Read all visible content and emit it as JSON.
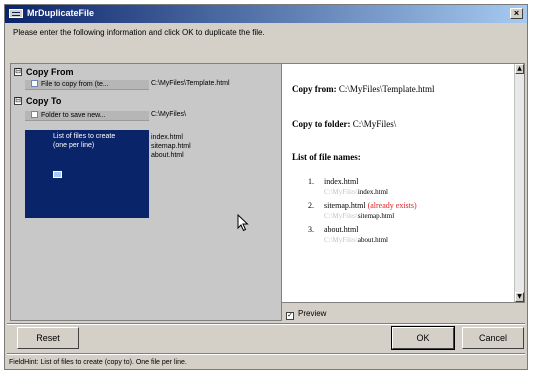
{
  "window": {
    "title": "MrDuplicateFile",
    "close_label": "×"
  },
  "instructions": "Please enter the following information and click OK to duplicate the file.",
  "grid": {
    "copy_from": {
      "header": "Copy From",
      "toggle": "⊟",
      "file_label": "File to copy from (te...",
      "file_value": "C:\\MyFiles\\Template.html"
    },
    "copy_to": {
      "header": "Copy To",
      "toggle": "⊟",
      "folder_label": "Folder to save new...",
      "folder_value": "C:\\MyFiles\\",
      "list_label_1": "List of files to create",
      "list_label_2": "(one per line)",
      "list_values": [
        "index.html",
        "sitemap.html",
        "about.html"
      ]
    }
  },
  "preview": {
    "copy_from_label": "Copy from:",
    "copy_from_value": "C:\\MyFiles\\Template.html",
    "copy_to_label": "Copy to folder:",
    "copy_to_value": "C:\\MyFiles\\",
    "list_label": "List of file names:",
    "files": [
      {
        "num": "1.",
        "name": "index.html",
        "status": "",
        "path_prefix": "C:\\MyFiles\\",
        "path_file": "index.html"
      },
      {
        "num": "2.",
        "name": "sitemap.html",
        "status": "(already exists)",
        "path_prefix": "C:\\MyFiles\\",
        "path_file": "sitemap.html"
      },
      {
        "num": "3.",
        "name": "about.html",
        "status": "",
        "path_prefix": "C:\\MyFiles\\",
        "path_file": "about.html"
      }
    ]
  },
  "preview_checkbox": {
    "label": "Preview",
    "checked": true
  },
  "buttons": {
    "reset": "Reset",
    "ok": "OK",
    "cancel": "Cancel"
  },
  "status_bar": "FieldHint: List of files to create (copy to). One file per line.",
  "colors": {
    "title_start": "#0a246a",
    "title_end": "#a6caf0",
    "selection": "#0a246a",
    "warning": "#e02020"
  }
}
